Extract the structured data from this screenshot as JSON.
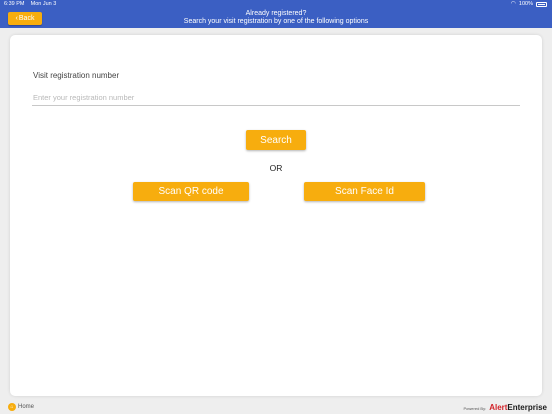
{
  "status_bar": {
    "time": "6:39 PM",
    "date": "Mon Jun 3",
    "battery": "100%",
    "wifi_icon": "wifi-icon",
    "battery_icon": "battery-icon"
  },
  "header": {
    "back_label": "Back",
    "title": "Already registered?",
    "subtitle": "Search your visit registration by one of the following options"
  },
  "form": {
    "field_label": "Visit registration number",
    "placeholder": "Enter your registration number",
    "value": ""
  },
  "actions": {
    "search_label": "Search",
    "or_text": "OR",
    "scan_qr_label": "Scan QR code",
    "scan_face_label": "Scan Face Id"
  },
  "footer": {
    "home_label": "Home",
    "powered_by": "Powered By:",
    "brand_prefix": "Alert",
    "brand_suffix": "Enterprise"
  },
  "colors": {
    "header_bg": "#3b5fc3",
    "accent": "#f7ad0e",
    "background": "#eeeeee",
    "brand_red": "#d22128"
  }
}
